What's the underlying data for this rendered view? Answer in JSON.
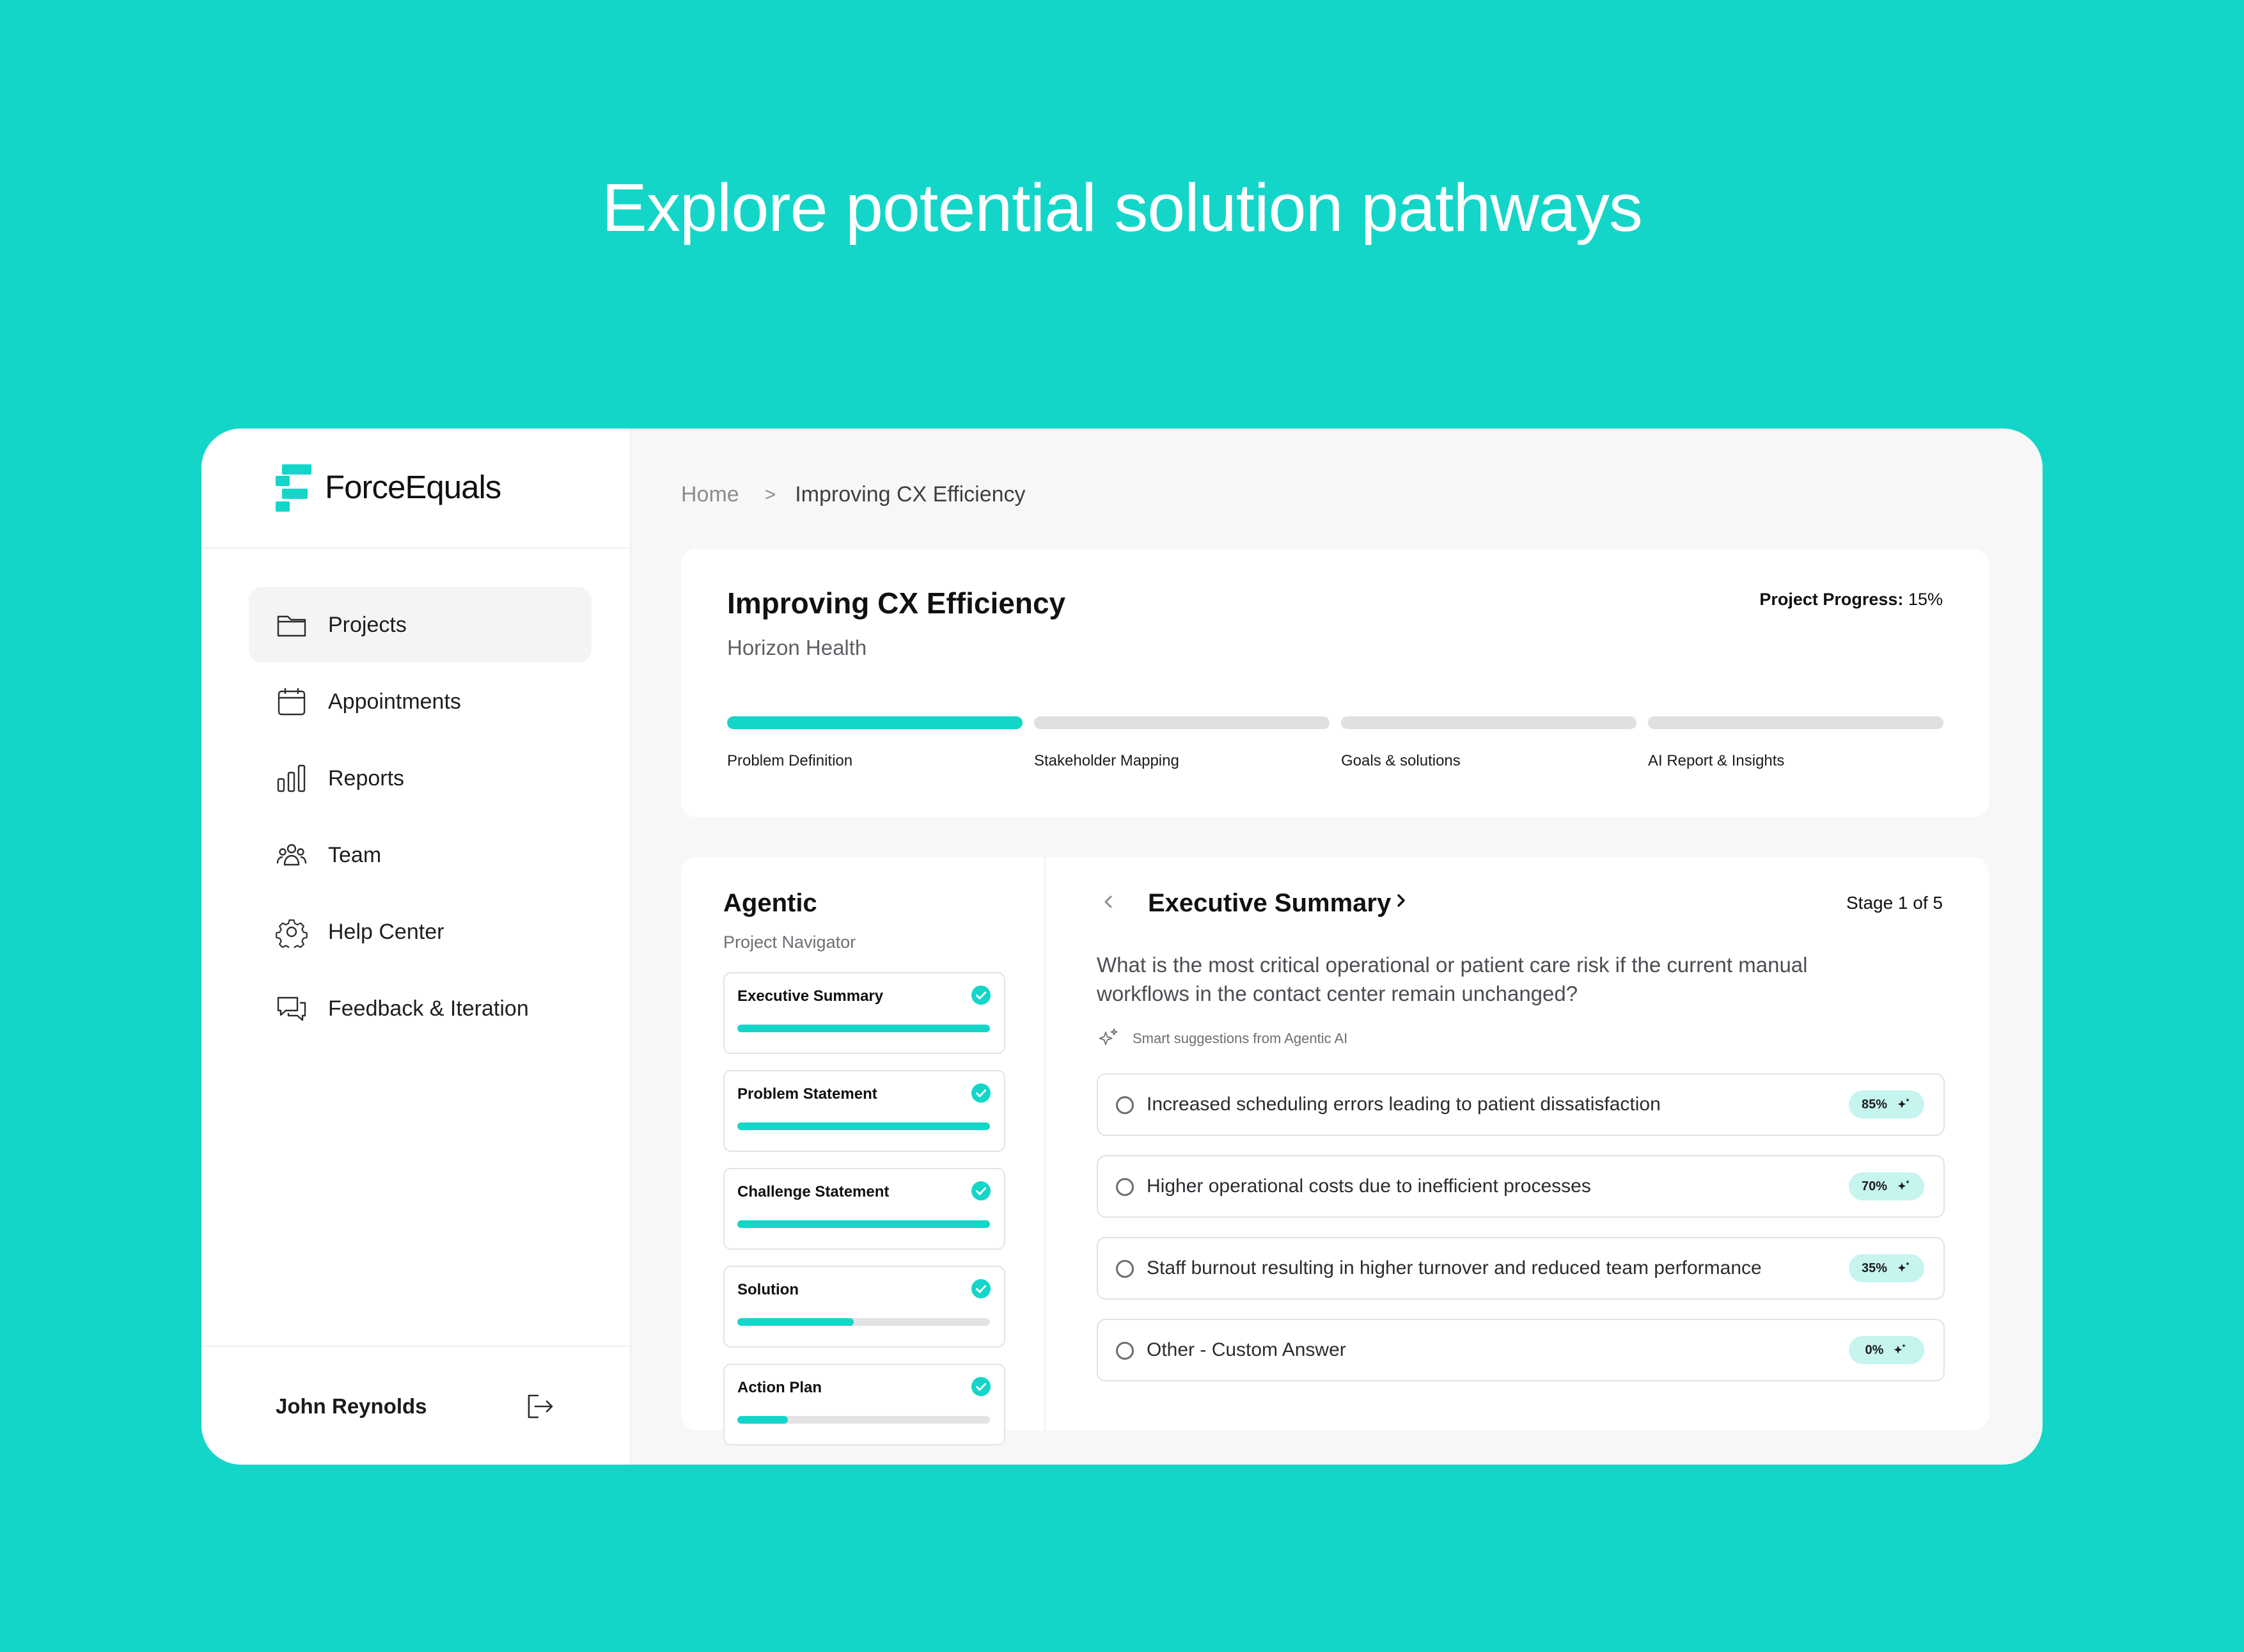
{
  "headline": "Explore potential solution pathways",
  "colors": {
    "accent": "#14d6c8",
    "background": "#14d6c8",
    "track": "#e3e3e3",
    "badge": "#c6f4ef"
  },
  "brand": {
    "name": "ForceEquals",
    "icon": "forceequals-logo"
  },
  "sidebar": {
    "items": [
      {
        "label": "Projects",
        "icon": "folder-icon",
        "active": true
      },
      {
        "label": "Appointments",
        "icon": "calendar-icon",
        "active": false
      },
      {
        "label": "Reports",
        "icon": "bar-chart-icon",
        "active": false
      },
      {
        "label": "Team",
        "icon": "team-icon",
        "active": false
      },
      {
        "label": "Help Center",
        "icon": "gear-icon",
        "active": false
      },
      {
        "label": "Feedback & Iteration",
        "icon": "chat-bubbles-icon",
        "active": false
      }
    ],
    "user": {
      "name": "John Reynolds",
      "logout_icon": "logout-icon"
    }
  },
  "breadcrumb": {
    "home": "Home",
    "separator": ">",
    "current": "Improving CX Efficiency"
  },
  "project": {
    "title": "Improving CX Efficiency",
    "client": "Horizon Health",
    "progress_label": "Project Progress:",
    "progress_value": "15%",
    "steps": [
      {
        "label": "Problem Definition",
        "complete": true
      },
      {
        "label": "Stakeholder Mapping",
        "complete": false
      },
      {
        "label": "Goals & solutions",
        "complete": false
      },
      {
        "label": "AI Report & Insights",
        "complete": false
      }
    ]
  },
  "navigator": {
    "title": "Agentic",
    "subtitle": "Project Navigator",
    "stages": [
      {
        "name": "Executive Summary",
        "progress": 1.0,
        "complete": true
      },
      {
        "name": "Problem Statement",
        "progress": 1.0,
        "complete": true
      },
      {
        "name": "Challenge Statement",
        "progress": 1.0,
        "complete": true
      },
      {
        "name": "Solution",
        "progress": 0.46,
        "complete": true
      },
      {
        "name": "Action Plan",
        "progress": 0.2,
        "complete": true
      }
    ]
  },
  "questionnaire": {
    "title": "Executive Summary",
    "stage_indicator": "Stage 1 of 5",
    "question": "What is the most critical operational or patient care risk if the current manual workflows in the contact center remain unchanged?",
    "smart_label": "Smart suggestions from Agentic AI",
    "options": [
      {
        "text": "Increased scheduling errors leading to patient dissatisfaction",
        "score": "85%"
      },
      {
        "text": "Higher operational costs due to inefficient processes",
        "score": "70%"
      },
      {
        "text": "Staff burnout resulting in higher turnover and reduced team performance",
        "score": "35%"
      },
      {
        "text": "Other - Custom Answer",
        "score": "0%"
      }
    ]
  }
}
